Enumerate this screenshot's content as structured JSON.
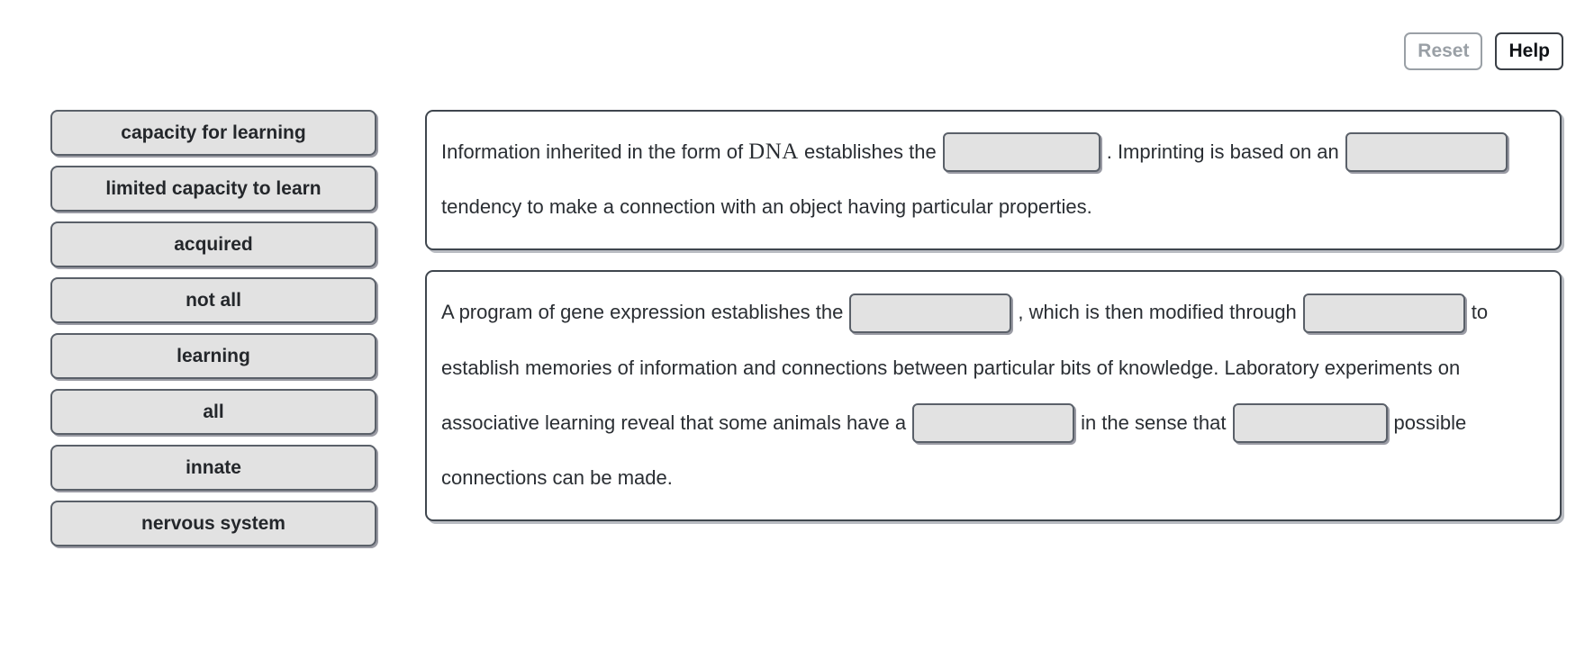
{
  "toolbar": {
    "reset_label": "Reset",
    "help_label": "Help"
  },
  "word_bank": {
    "tiles": [
      {
        "label": "capacity for learning"
      },
      {
        "label": "limited capacity to learn"
      },
      {
        "label": "acquired"
      },
      {
        "label": "not all"
      },
      {
        "label": "learning"
      },
      {
        "label": "all"
      },
      {
        "label": "innate"
      },
      {
        "label": "nervous system"
      }
    ]
  },
  "panels": [
    {
      "id": "panel-1",
      "segments": [
        {
          "type": "text",
          "value": "Information inherited in the form of "
        },
        {
          "type": "serif",
          "value": "DNA"
        },
        {
          "type": "text",
          "value": " establishes the"
        },
        {
          "type": "blank",
          "value": ""
        },
        {
          "type": "text",
          "value": ". Imprinting is based on an"
        },
        {
          "type": "blank",
          "value": ""
        },
        {
          "type": "text",
          "value": "tendency to make a connection with an object having particular properties."
        }
      ]
    },
    {
      "id": "panel-2",
      "segments": [
        {
          "type": "text",
          "value": "A program of gene expression establishes the"
        },
        {
          "type": "blank",
          "value": ""
        },
        {
          "type": "text",
          "value": ", which is then modified through"
        },
        {
          "type": "blank",
          "value": ""
        },
        {
          "type": "text",
          "value": "to establish memories of information and connections between particular bits of knowledge. Laboratory experiments on associative learning reveal that some animals have a"
        },
        {
          "type": "blank",
          "value": ""
        },
        {
          "type": "text",
          "value": "in the sense that"
        },
        {
          "type": "blank",
          "value": ""
        },
        {
          "type": "text",
          "value": "possible connections can be made."
        }
      ]
    }
  ],
  "colors": {
    "tile_fill": "#e2e2e2",
    "tile_border": "#5a6069",
    "panel_border": "#3f464e",
    "reset_disabled": "#9aa0a6",
    "text": "#2a2e33",
    "page_background": "#ffffff"
  }
}
